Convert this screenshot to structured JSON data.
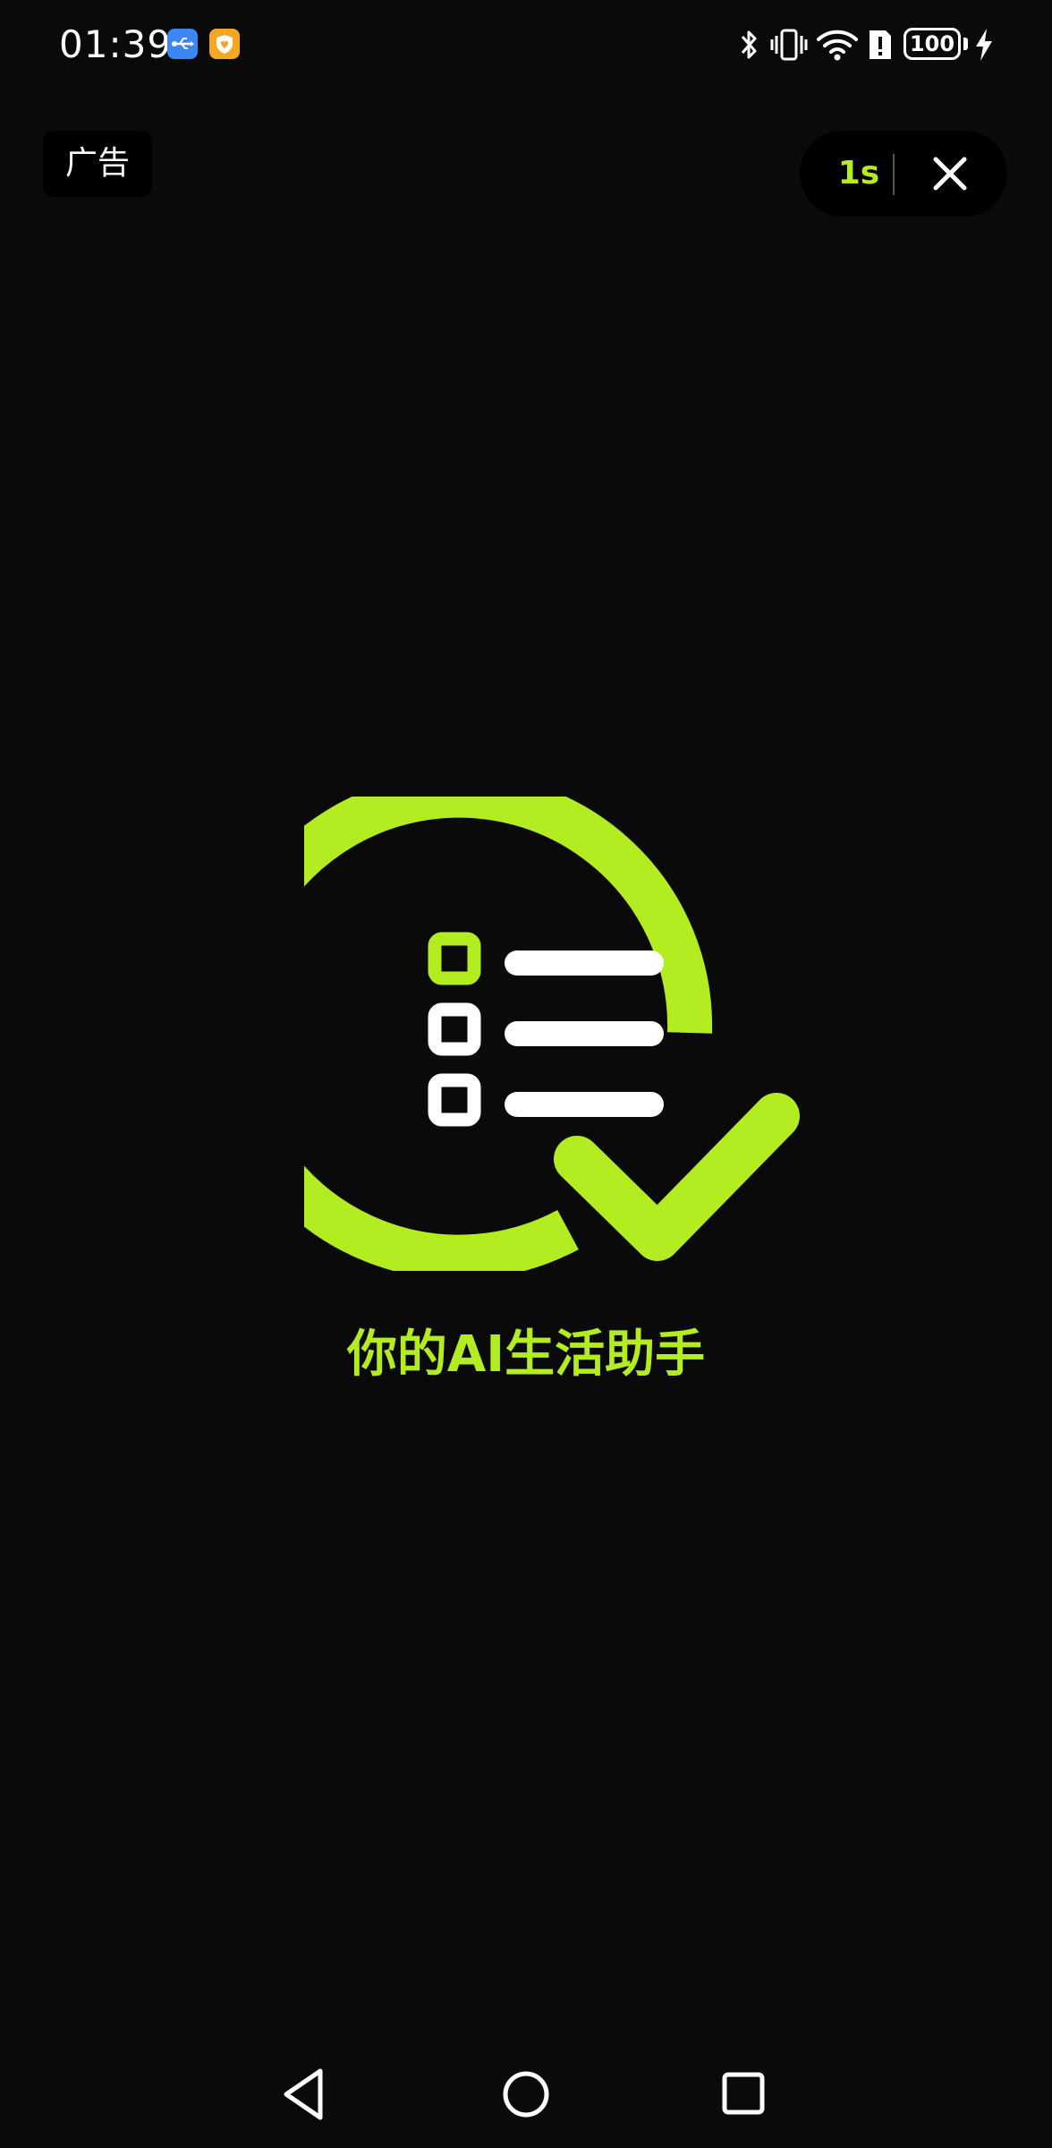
{
  "status_bar": {
    "time": "01:39",
    "notifications": [
      "usb-icon",
      "shield-icon"
    ],
    "system_icons": [
      "bluetooth-icon",
      "vibrate-icon",
      "wifi-icon",
      "alert-icon",
      "battery-icon",
      "charging-icon"
    ],
    "battery_level": "100"
  },
  "ad": {
    "label": "广告"
  },
  "skip": {
    "countdown": "1s",
    "close_icon": "close-icon"
  },
  "splash": {
    "logo_icon": "checklist-check-icon",
    "slogan": "你的AI生活助手"
  },
  "nav_bar": {
    "buttons": [
      "back-icon",
      "home-icon",
      "recent-apps-icon"
    ]
  },
  "colors": {
    "background": "#0a0a0a",
    "accent": "#b4ec22",
    "text": "#ffffff"
  }
}
